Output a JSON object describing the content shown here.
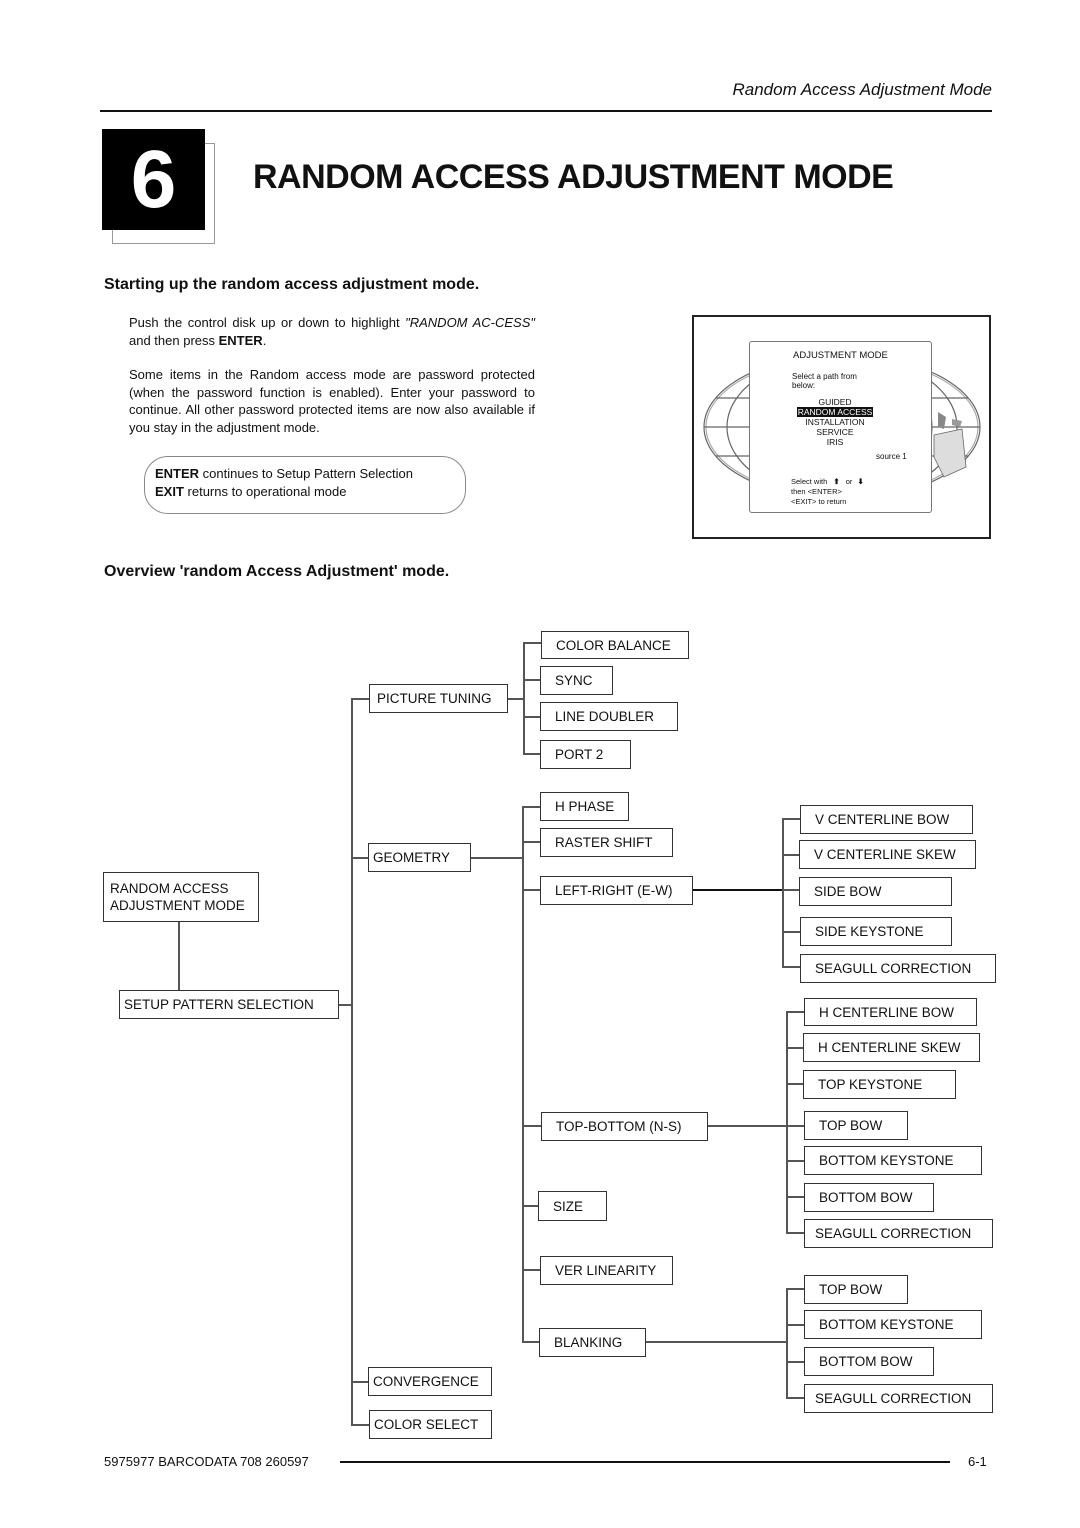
{
  "running_head": "Random Access Adjustment Mode",
  "chapter": {
    "number": "6",
    "title": "RANDOM ACCESS ADJUSTMENT MODE"
  },
  "section1": {
    "heading": "Starting up the random access adjustment mode.",
    "para1_a": "Push the control disk up or down to highlight ",
    "para1_italic": "\"RANDOM AC-CESS\"",
    "para1_b": " and then press ",
    "para1_bold": "ENTER",
    "para1_c": ".",
    "para2": "Some items in the Random access mode are password protected (when the password function is enabled).  Enter your password to continue.  All other password protected items are now also available if you stay in the adjustment mode.",
    "callout": {
      "line1_bold": "ENTER",
      "line1_rest": " continues to Setup Pattern Selection",
      "line2_bold": "EXIT",
      "line2_rest": " returns to operational mode"
    }
  },
  "osd": {
    "title": "ADJUSTMENT MODE",
    "prompt1": "Select a path from",
    "prompt2": "below:",
    "items": [
      "GUIDED",
      "RANDOM ACCESS",
      "INSTALLATION",
      "SERVICE",
      "IRIS"
    ],
    "selected": "RANDOM ACCESS",
    "source": "source 1",
    "hint1": "Select with",
    "hint_or": "or",
    "hint2": "then <ENTER>",
    "hint3": "<EXIT> to return"
  },
  "section2": {
    "heading": "Overview 'random Access Adjustment' mode."
  },
  "diagram": {
    "root_line1": "RANDOM ACCESS",
    "root_line2": "ADJUSTMENT MODE",
    "setup": "SETUP PATTERN SELECTION",
    "level1": [
      "PICTURE TUNING",
      "GEOMETRY",
      "CONVERGENCE",
      "COLOR SELECT"
    ],
    "picture_tuning": [
      "COLOR BALANCE",
      "SYNC",
      "LINE DOUBLER",
      "PORT 2"
    ],
    "geometry": [
      "H PHASE",
      "RASTER SHIFT",
      "LEFT-RIGHT (E-W)",
      "TOP-BOTTOM (N-S)",
      "SIZE",
      "VER LINEARITY",
      "BLANKING"
    ],
    "left_right": [
      "V CENTERLINE BOW",
      "V CENTERLINE SKEW",
      "SIDE BOW",
      "SIDE KEYSTONE",
      "SEAGULL CORRECTION"
    ],
    "top_bottom": [
      "H CENTERLINE BOW",
      "H CENTERLINE SKEW",
      "TOP KEYSTONE",
      "TOP BOW",
      "BOTTOM KEYSTONE",
      "BOTTOM BOW",
      "SEAGULL CORRECTION"
    ],
    "blanking": [
      "TOP BOW",
      "BOTTOM KEYSTONE",
      "BOTTOM BOW",
      "SEAGULL CORRECTION"
    ]
  },
  "footer": {
    "doc_id": "5975977 BARCODATA 708 260597",
    "page": "6-1"
  }
}
